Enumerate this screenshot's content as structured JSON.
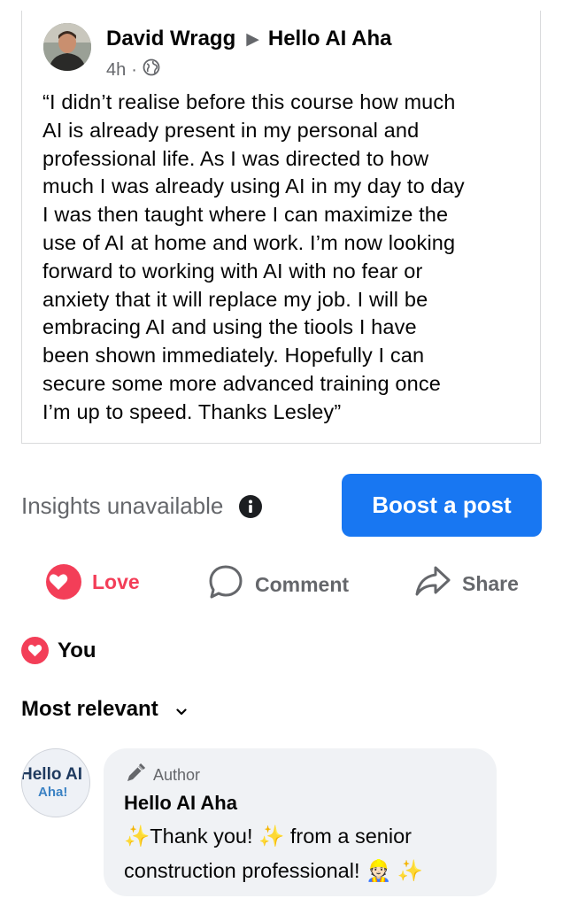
{
  "post": {
    "author": "David Wragg",
    "arrow": "▶",
    "group": "Hello AI Aha",
    "time": "4h",
    "dot": "·",
    "text": "“I didn’t realise before this course how much\nAI is already present in my personal and\nprofessional life. As I was directed to how\nmuch I was already using AI in my day to day\nI was then taught where I can maximize the\nuse of AI at home and work. I’m now looking\nforward to working with AI with no fear or\nanxiety that it will replace my job. I will be\nembracing AI and using the tiools I have\nbeen shown immediately. Hopefully I can\nsecure some more advanced training once\nI’m up to speed. Thanks Lesley”"
  },
  "insights": {
    "label": "Insights unavailable",
    "boost_label": "Boost a post"
  },
  "actions": {
    "love": "Love",
    "comment": "Comment",
    "share": "Share"
  },
  "reactions": {
    "label": "You"
  },
  "sort": {
    "label": "Most relevant"
  },
  "comment": {
    "avatar_line1": "Hello AI",
    "avatar_line2": "Aha!",
    "badge": "Author",
    "name": "Hello AI Aha",
    "part1": "Thank you!",
    "part2": "from a senior",
    "part3": "construction professional!",
    "emoji_worker": "👷🏻",
    "sparkle": "✨"
  },
  "colors": {
    "accent": "#1877f2",
    "love": "#f33e58",
    "muted": "#65676b"
  }
}
